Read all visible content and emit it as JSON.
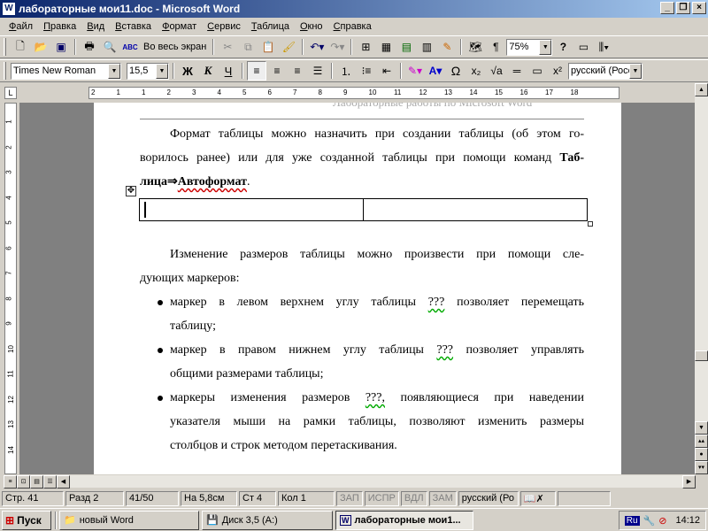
{
  "window": {
    "title": "лабораторные мои11.doc - Microsoft Word",
    "app_icon": "W"
  },
  "menu": [
    "Файл",
    "Правка",
    "Вид",
    "Вставка",
    "Формат",
    "Сервис",
    "Таблица",
    "Окно",
    "Справка"
  ],
  "toolbar_standard": {
    "fullscreen_label": "Во весь экран",
    "zoom": "75%"
  },
  "toolbar_format": {
    "font": "Times New Roman",
    "size": "15,5",
    "bold": "Ж",
    "italic": "К",
    "underline": "Ч",
    "language": "русский (Росс"
  },
  "document": {
    "faded_header": "Лабораторные работы по Microsoft Word",
    "para1_line1": "Формат таблицы можно назначить при создании таблицы (об этом го-",
    "para1_line2_plain": "ворилось ранее) или для уже созданной таблицы при помощи команд ",
    "para1_line2_bold": "Таб-",
    "para1_line3_bold1": "лица",
    "para1_line3_arrow": "⇒",
    "para1_line3_bold2": "Автоформат",
    "para1_line3_end": ".",
    "para2_line1": "Изменение размеров таблицы можно произвести при помощи сле-",
    "para2_line2": "дующих маркеров:",
    "bullet1_line1_a": "маркер в левом верхнем углу таблицы",
    "bullet1_marker": "???",
    "bullet1_line1_b": "позволяет перемещать",
    "bullet1_line2": "таблицу;",
    "bullet2_line1_a": "маркер в правом нижнем углу таблицы",
    "bullet2_marker": "???",
    "bullet2_line1_b": "позволяет управлять",
    "bullet2_line2": "общими размерами таблицы;",
    "bullet3_line1_a": "маркеры изменения размеров",
    "bullet3_marker": "???,",
    "bullet3_line1_b": "появляющиеся при наведении",
    "bullet3_line2": "указателя мыши на рамки таблицы, позволяют изменить размеры",
    "bullet3_line3": "столбцов и строк методом перетаскивания."
  },
  "status": {
    "page": "Стр. 41",
    "section": "Разд 2",
    "pages": "41/50",
    "at": "На 5,8см",
    "line": "Ст 4",
    "col": "Кол 1",
    "rec": "ЗАП",
    "trk": "ИСПР",
    "ext": "ВДЛ",
    "ovr": "ЗАМ",
    "lang": "русский (Ро"
  },
  "taskbar": {
    "start": "Пуск",
    "tasks": [
      "новый Word",
      "Диск 3,5 (A:)",
      "лабораторные мои1..."
    ],
    "lang": "Ru",
    "clock": "14:12"
  },
  "ruler_numbers": [
    "2",
    "1",
    "1",
    "2",
    "3",
    "4",
    "5",
    "6",
    "7",
    "8",
    "9",
    "10",
    "11",
    "12",
    "13",
    "14",
    "15",
    "16",
    "17",
    "18"
  ],
  "vruler_numbers": [
    "1",
    "2",
    "3",
    "4",
    "5",
    "6",
    "7",
    "8",
    "9",
    "10",
    "11",
    "12",
    "13",
    "14"
  ]
}
